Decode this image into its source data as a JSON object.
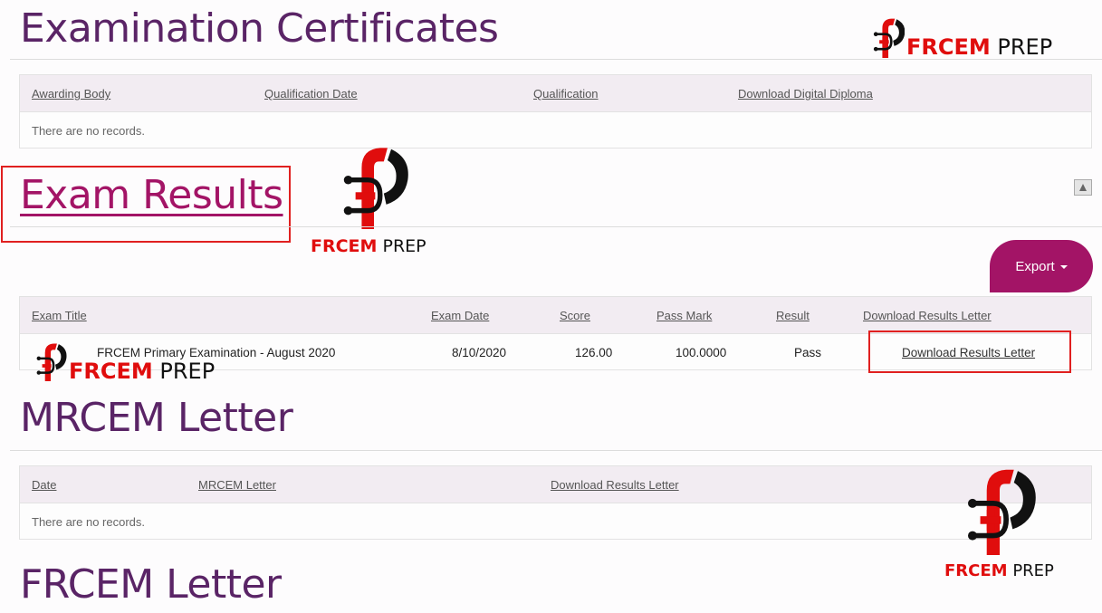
{
  "brand": {
    "logo_red": "FRCEM",
    "logo_black": "PREP",
    "accent": "#a31466",
    "title_color": "#5a2466"
  },
  "certificates": {
    "title": "Examination Certificates",
    "columns": [
      "Awarding Body",
      "Qualification Date",
      "Qualification",
      "Download Digital Diploma"
    ],
    "empty_text": "There are no records."
  },
  "exam_results": {
    "title": "Exam Results",
    "export_label": "Export",
    "columns": [
      "Exam Title",
      "Exam Date",
      "Score",
      "Pass Mark",
      "Result",
      "Download Results Letter"
    ],
    "rows": [
      {
        "exam_title": "FRCEM Primary Examination - August 2020",
        "exam_date": "8/10/2020",
        "score": "126.00",
        "pass_mark": "100.0000",
        "result": "Pass",
        "download": "Download Results Letter"
      }
    ]
  },
  "mrcem_letter": {
    "title": "MRCEM Letter",
    "columns": [
      "Date",
      "MRCEM Letter",
      "Download Results Letter"
    ],
    "empty_text": "There are no records."
  },
  "frcem_letter": {
    "title": "FRCEM Letter"
  }
}
